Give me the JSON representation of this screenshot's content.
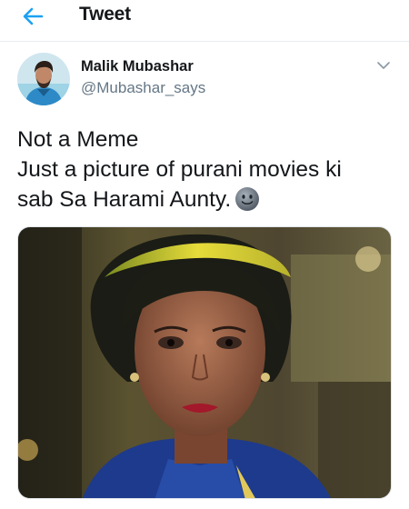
{
  "header": {
    "title": "Tweet",
    "back_icon": "arrow-left-icon",
    "accent": "#1da1f2"
  },
  "author": {
    "name": "Malik Mubashar",
    "handle": "@Mubashar_says",
    "menu_icon": "chevron-down-icon"
  },
  "tweet": {
    "lines": [
      "Not a Meme",
      "Just a picture of purani movies ki",
      "sab Sa Harami Aunty."
    ],
    "emoji_icon": "slightly-smiling-face-icon"
  },
  "media": {
    "type": "photo"
  },
  "colors": {
    "text": "#14171a",
    "secondary": "#657786",
    "divider": "#e6ecf0"
  }
}
